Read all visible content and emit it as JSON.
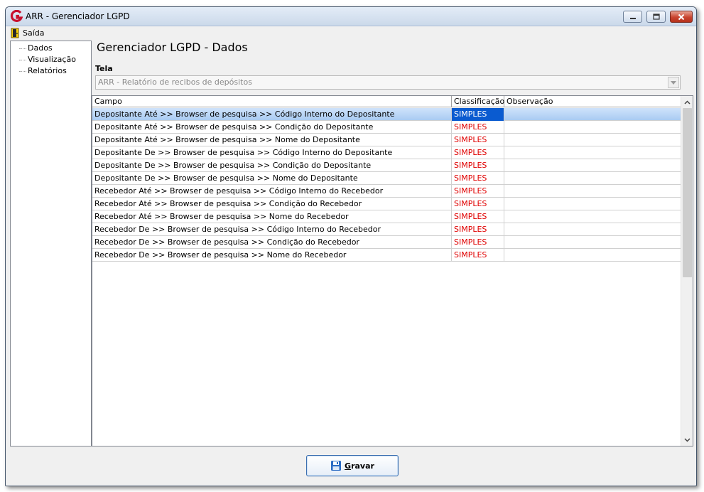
{
  "window": {
    "title": "ARR - Gerenciador LGPD",
    "icons": {
      "app": "app-logo-icon",
      "minimize": "minimize-icon",
      "maximize": "maximize-icon",
      "close": "close-icon"
    }
  },
  "menu": {
    "exit_label": "Saída",
    "exit_icon": "exit-door-icon"
  },
  "sidebar": {
    "items": [
      {
        "label": "Dados"
      },
      {
        "label": "Visualização"
      },
      {
        "label": "Relatórios"
      }
    ]
  },
  "main": {
    "title": "Gerenciador LGPD - Dados",
    "tela_label": "Tela",
    "tela_value": "ARR - Relatório de recibos de depósitos"
  },
  "table": {
    "columns": [
      "Campo",
      "Classificação",
      "Observação"
    ],
    "selected_row": 0,
    "rows": [
      {
        "campo": "Depositante Até >> Browser de pesquisa >> Código Interno do Depositante",
        "classificacao": "SIMPLES",
        "observacao": ""
      },
      {
        "campo": "Depositante Até >> Browser de pesquisa >> Condição do Depositante",
        "classificacao": "SIMPLES",
        "observacao": ""
      },
      {
        "campo": "Depositante Até >> Browser de pesquisa >> Nome do Depositante",
        "classificacao": "SIMPLES",
        "observacao": ""
      },
      {
        "campo": "Depositante De >> Browser de pesquisa >> Código Interno do Depositante",
        "classificacao": "SIMPLES",
        "observacao": ""
      },
      {
        "campo": "Depositante De >> Browser de pesquisa >> Condição do Depositante",
        "classificacao": "SIMPLES",
        "observacao": ""
      },
      {
        "campo": "Depositante De >> Browser de pesquisa >> Nome do Depositante",
        "classificacao": "SIMPLES",
        "observacao": ""
      },
      {
        "campo": "Recebedor Até >> Browser de pesquisa >> Código Interno do Recebedor",
        "classificacao": "SIMPLES",
        "observacao": ""
      },
      {
        "campo": "Recebedor Até >> Browser de pesquisa >> Condição do Recebedor",
        "classificacao": "SIMPLES",
        "observacao": ""
      },
      {
        "campo": "Recebedor Até >> Browser de pesquisa >> Nome do Recebedor",
        "classificacao": "SIMPLES",
        "observacao": ""
      },
      {
        "campo": "Recebedor De >> Browser de pesquisa >> Código Interno do Recebedor",
        "classificacao": "SIMPLES",
        "observacao": ""
      },
      {
        "campo": "Recebedor De >> Browser de pesquisa >> Condição do Recebedor",
        "classificacao": "SIMPLES",
        "observacao": ""
      },
      {
        "campo": "Recebedor De >> Browser de pesquisa >> Nome do Recebedor",
        "classificacao": "SIMPLES",
        "observacao": ""
      }
    ]
  },
  "footer": {
    "save_label": "Gravar",
    "save_icon": "floppy-disk-icon"
  },
  "colors": {
    "classification_text": "#e00000",
    "selected_row": "#a9cbf2",
    "selected_cell": "#0a5bd0",
    "button_border": "#3b6fb0"
  }
}
